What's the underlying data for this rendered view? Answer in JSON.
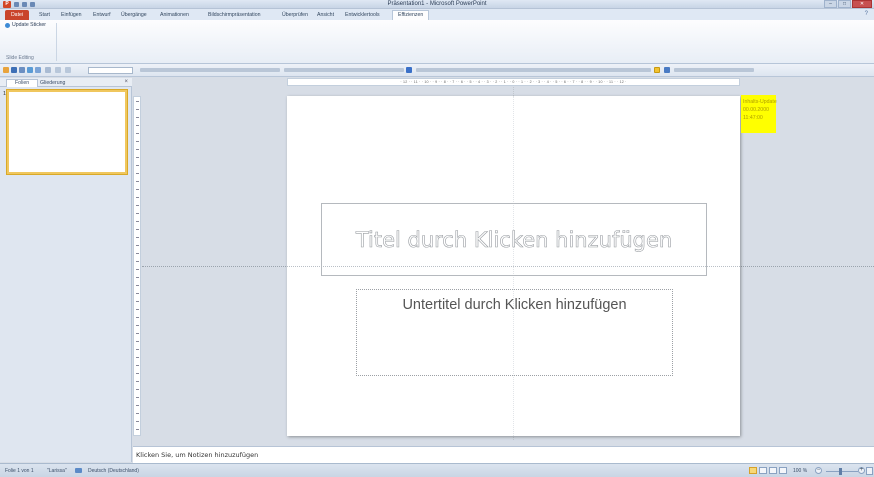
{
  "window": {
    "title": "Präsentation1 - Microsoft PowerPoint",
    "controls": [
      "–",
      "□",
      "✕"
    ]
  },
  "ribbon": {
    "tabs": [
      "Datei",
      "Start",
      "Einfügen",
      "Entwurf",
      "Übergänge",
      "Animationen",
      "Bildschirmpräsentation",
      "Überprüfen",
      "Ansicht",
      "Entwicklertools",
      "Effizienzen"
    ],
    "active_tab": "Effizienzen",
    "update_sticker_label": "Update Sticker",
    "group_label": "Slide Editing"
  },
  "left_panel": {
    "tab_slides": "Folien",
    "tab_outline": "Gliederung",
    "slide_number": "1"
  },
  "ruler": {
    "horizontal": "· 12 · · 11 · · 10 · · 9 · · 8 · · 7 · · 6 · · 5 · · 4 · · 3 · · 2 · · 1 · · 0 · · 1 · · 2 · · 3 · · 4 · · 5 · · 6 · · 7 · · 8 · · 9 · · 10 · · 11 · · 12 ·"
  },
  "slide": {
    "title_placeholder": "Titel durch Klicken hinzufügen",
    "subtitle_placeholder": "Untertitel durch Klicken hinzufügen"
  },
  "sticker": {
    "line1": "Inhalts-Update",
    "line2": "00.00.2000",
    "line3": "11:47:00"
  },
  "notes": {
    "placeholder": "Klicken Sie, um Notizen hinzuzufügen"
  },
  "status": {
    "slide_info": "Folie 1 von 1",
    "theme": "\"Larissa\"",
    "language": "Deutsch (Deutschland)",
    "zoom": "100 %",
    "zoom_fraction": 0.45
  },
  "colors": {
    "file_tab": "#c9452b",
    "sticker": "#ffff00",
    "selected_thumb_border": "#f0c75e"
  }
}
